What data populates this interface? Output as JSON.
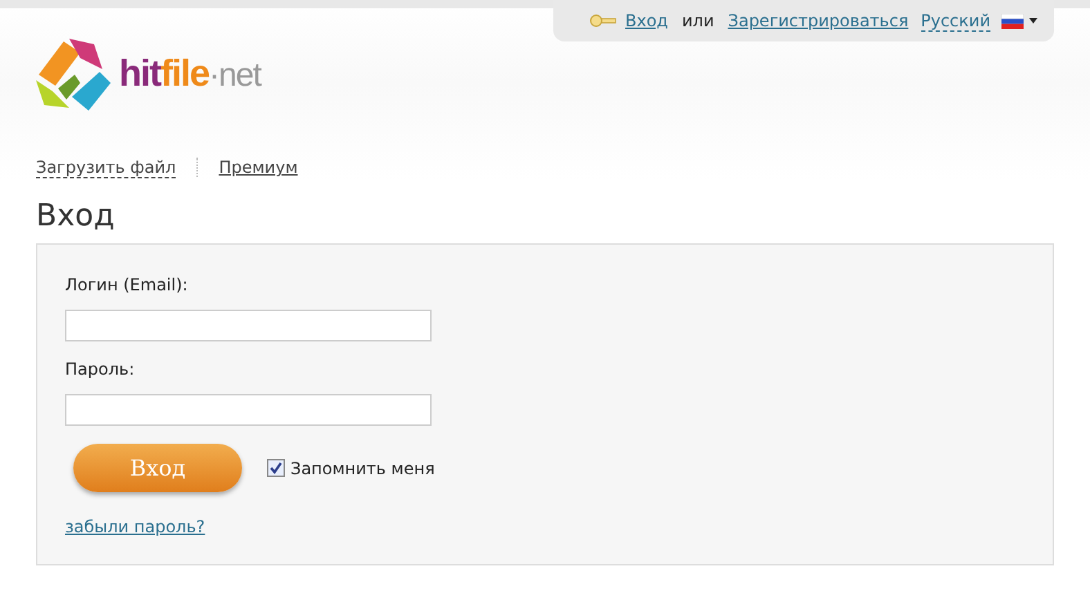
{
  "top_bar": {
    "login_link": "Вход",
    "or_text": "или",
    "register_link": "Зарегистрироваться",
    "language": "Русский"
  },
  "logo": [
    "hit",
    "file",
    "·net"
  ],
  "nav": [
    "Загрузить файл",
    "Премиум"
  ],
  "heading": "Вход",
  "form": {
    "login_label": "Логин (Email):",
    "password_label": "Пароль:",
    "submit": "Вход",
    "remember": {
      "label": "Запомнить меня",
      "checked": true
    },
    "forgot_link": "забыли пароль?"
  }
}
